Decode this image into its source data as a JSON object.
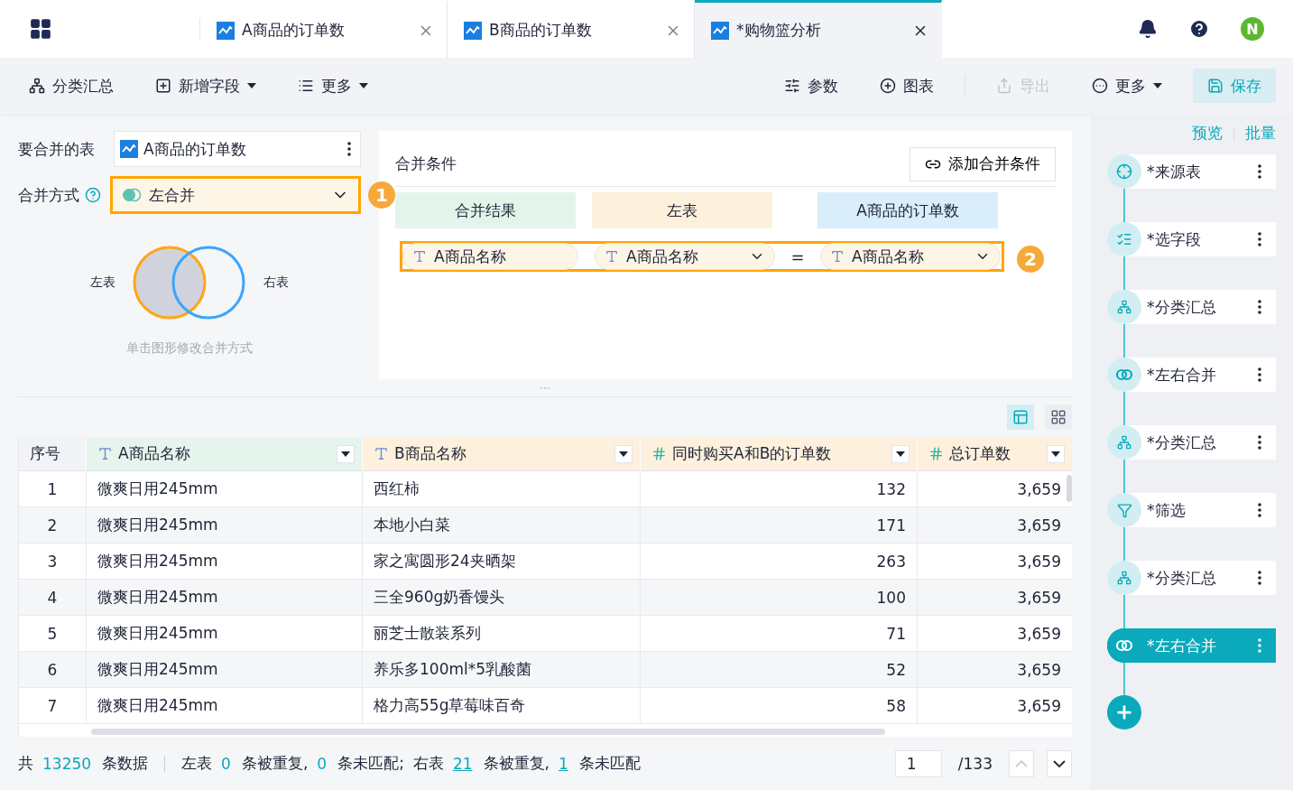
{
  "tabs": [
    {
      "label": "A商品的订单数",
      "selected": false
    },
    {
      "label": "B商品的订单数",
      "selected": false
    },
    {
      "label": "*购物篮分析",
      "selected": true
    }
  ],
  "user": {
    "initial": "N"
  },
  "toolbar": {
    "left": [
      {
        "label": "分类汇总",
        "kind": "group",
        "dropdown": false,
        "disabled": false
      },
      {
        "label": "新增字段",
        "kind": "add-field",
        "dropdown": true,
        "disabled": false
      },
      {
        "label": "更多",
        "kind": "list",
        "dropdown": true,
        "disabled": false
      }
    ],
    "right": [
      {
        "label": "参数",
        "kind": "params",
        "dropdown": false,
        "disabled": false
      },
      {
        "label": "图表",
        "kind": "chart",
        "dropdown": false,
        "disabled": false
      },
      {
        "label": "导出",
        "kind": "export",
        "dropdown": false,
        "disabled": true
      },
      {
        "label": "更多",
        "kind": "more",
        "dropdown": true,
        "disabled": false
      }
    ],
    "save": "保存"
  },
  "merge": {
    "table_label": "要合并的表",
    "table_value": "A商品的订单数",
    "method_label": "合并方式",
    "method_value": "左合并",
    "step_badge": "1",
    "venn_left": "左表",
    "venn_right": "右表",
    "hint": "单击图形修改合并方式"
  },
  "conditions": {
    "title": "合并条件",
    "add_button": "添加合并条件",
    "headers": [
      {
        "label": "合并结果",
        "color": "#e3f4ea"
      },
      {
        "label": "左表",
        "color": "#fdf0dc"
      },
      {
        "label": "A商品的订单数",
        "color": "#d9edfb"
      }
    ],
    "rows": [
      {
        "result": "A商品名称",
        "left": "A商品名称",
        "operator": "=",
        "right": "A商品名称"
      }
    ],
    "step_badge": "2"
  },
  "table": {
    "columns": [
      {
        "label": "序号",
        "kind": "index",
        "color": "#f2f3f7"
      },
      {
        "label": "A商品名称",
        "kind": "text",
        "color": "#e5f4ec"
      },
      {
        "label": "B商品名称",
        "kind": "text",
        "color": "#fdf0dc"
      },
      {
        "label": "同时购买A和B的订单数",
        "kind": "number",
        "color": "#fdf0dc"
      },
      {
        "label": "总订单数",
        "kind": "number",
        "color": "#fdf0dc"
      }
    ],
    "rows": [
      [
        "1",
        "微爽日用245mm",
        "西红柿",
        "132",
        "3,659"
      ],
      [
        "2",
        "微爽日用245mm",
        "本地小白菜",
        "171",
        "3,659"
      ],
      [
        "3",
        "微爽日用245mm",
        "家之寓圆形24夹晒架",
        "263",
        "3,659"
      ],
      [
        "4",
        "微爽日用245mm",
        "三全960g奶香馒头",
        "100",
        "3,659"
      ],
      [
        "5",
        "微爽日用245mm",
        "丽芝士散装系列",
        "71",
        "3,659"
      ],
      [
        "6",
        "微爽日用245mm",
        "养乐多100ml*5乳酸菌",
        "52",
        "3,659"
      ],
      [
        "7",
        "微爽日用245mm",
        "格力高55g草莓味百奇",
        "58",
        "3,659"
      ]
    ]
  },
  "footer": {
    "summary": [
      {
        "text": "共",
        "kind": "plain"
      },
      {
        "text": "13250",
        "kind": "count"
      },
      {
        "text": "条数据",
        "kind": "plain",
        "divider_after": true
      },
      {
        "text": "左表",
        "kind": "plain"
      },
      {
        "text": "0",
        "kind": "count"
      },
      {
        "text": "条被重复,",
        "kind": "plain"
      },
      {
        "text": "0",
        "kind": "count"
      },
      {
        "text": "条未匹配;",
        "kind": "plain"
      },
      {
        "text": "右表",
        "kind": "plain"
      },
      {
        "text": "21",
        "kind": "link"
      },
      {
        "text": "条被重复,",
        "kind": "plain"
      },
      {
        "text": "1",
        "kind": "link"
      },
      {
        "text": "条未匹配",
        "kind": "plain"
      }
    ],
    "page": "1",
    "pages": "/133",
    "prev_disabled": true
  },
  "sidebar": {
    "links": [
      "预览",
      "批量"
    ],
    "steps": [
      {
        "label": "*来源表",
        "kind": "source",
        "selected": false
      },
      {
        "label": "*选字段",
        "kind": "fields",
        "selected": false
      },
      {
        "label": "*分类汇总",
        "kind": "group",
        "selected": false
      },
      {
        "label": "*左右合并",
        "kind": "merge",
        "selected": false
      },
      {
        "label": "*分类汇总",
        "kind": "group",
        "selected": false
      },
      {
        "label": "*筛选",
        "kind": "filter",
        "selected": false
      },
      {
        "label": "*分类汇总",
        "kind": "group",
        "selected": false
      },
      {
        "label": "*左右合并",
        "kind": "merge",
        "selected": true
      }
    ]
  }
}
